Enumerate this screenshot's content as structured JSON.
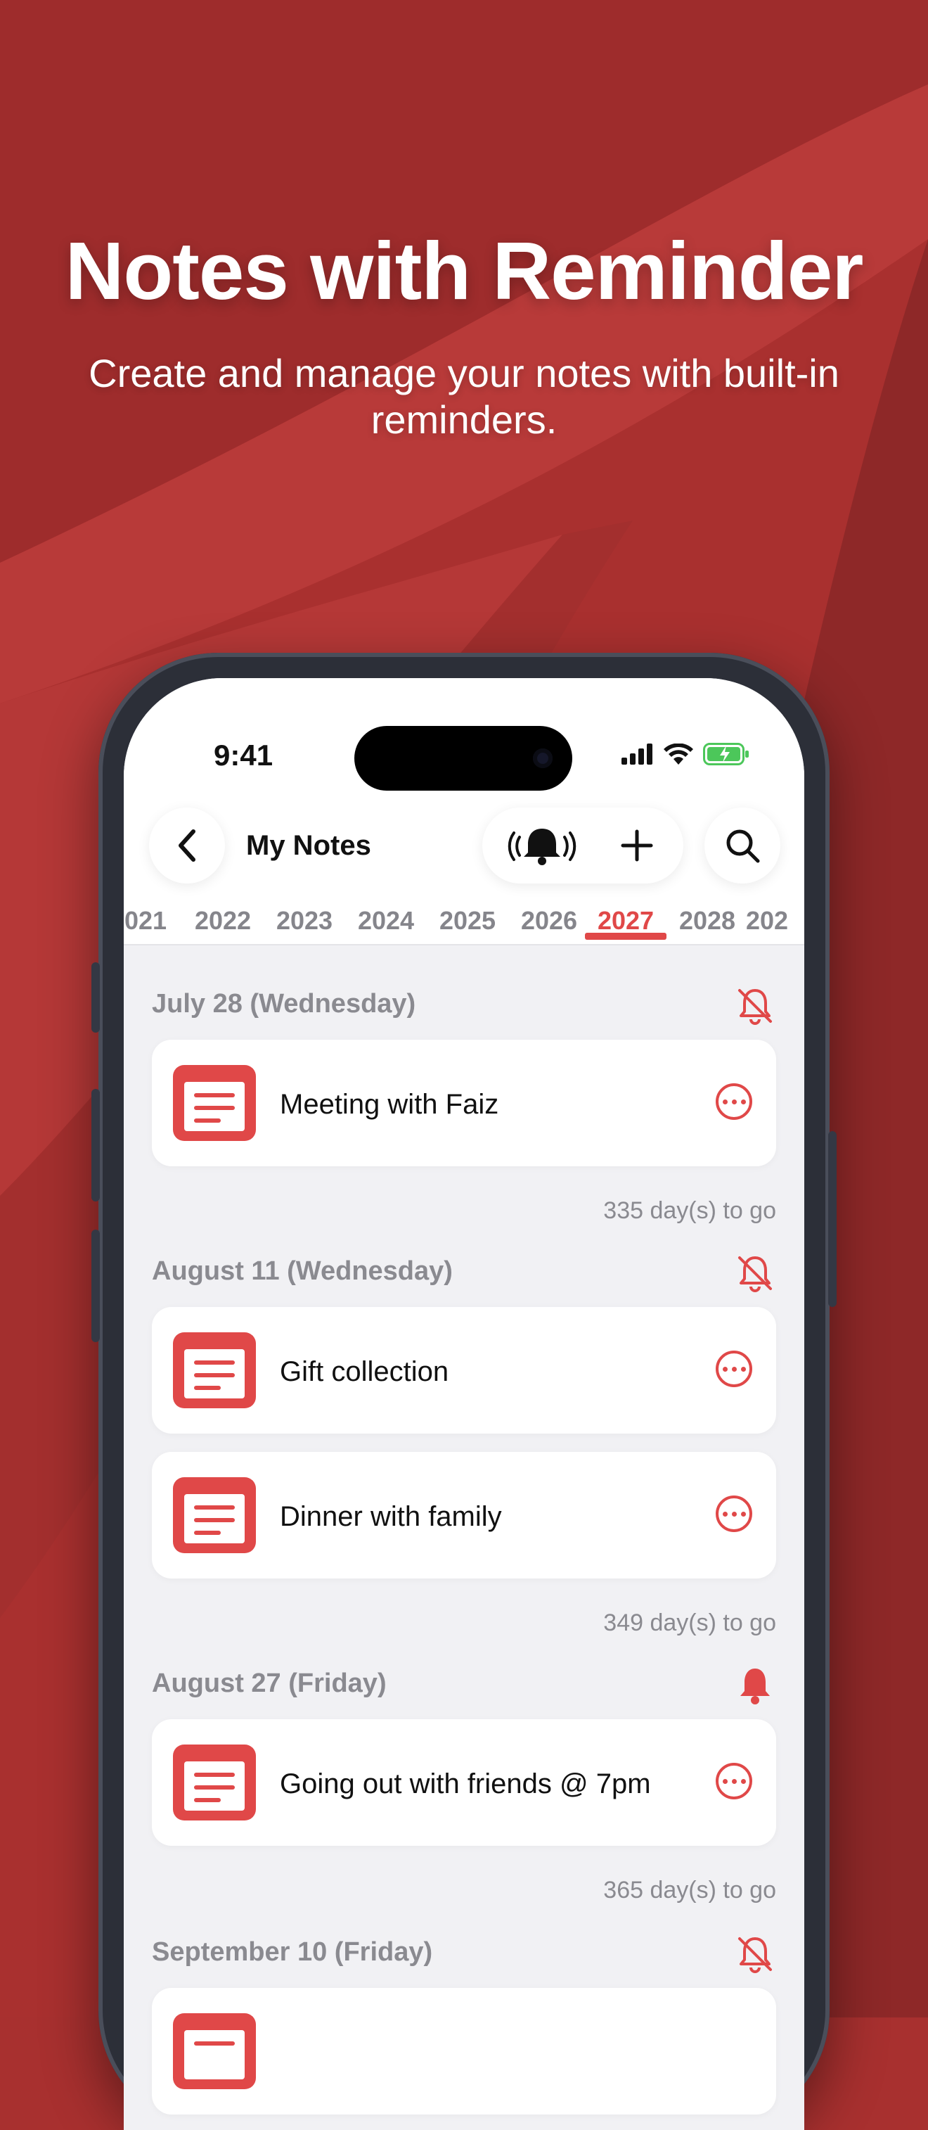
{
  "hero": {
    "title": "Notes with Reminder",
    "subtitle": "Create and manage your notes with built-in reminders."
  },
  "status_bar": {
    "time": "9:41"
  },
  "nav": {
    "title": "My Notes"
  },
  "years": [
    "021",
    "2022",
    "2023",
    "2024",
    "2025",
    "2026",
    "2027",
    "2028",
    "202"
  ],
  "active_year": "2027",
  "sections": [
    {
      "date": "July 28 (Wednesday)",
      "reminder": "off",
      "notes": [
        "Meeting with Faiz"
      ],
      "countdown": "335 day(s) to go"
    },
    {
      "date": "August 11 (Wednesday)",
      "reminder": "off",
      "notes": [
        "Gift collection",
        "Dinner with family"
      ],
      "countdown": "349 day(s) to go"
    },
    {
      "date": "August 27 (Friday)",
      "reminder": "on",
      "notes": [
        "Going out with friends @ 7pm"
      ],
      "countdown": "365 day(s) to go"
    },
    {
      "date": "September 10 (Friday)",
      "reminder": "off",
      "notes": [],
      "countdown": ""
    }
  ],
  "colors": {
    "accent": "#e04848",
    "background": "#a8302f"
  }
}
